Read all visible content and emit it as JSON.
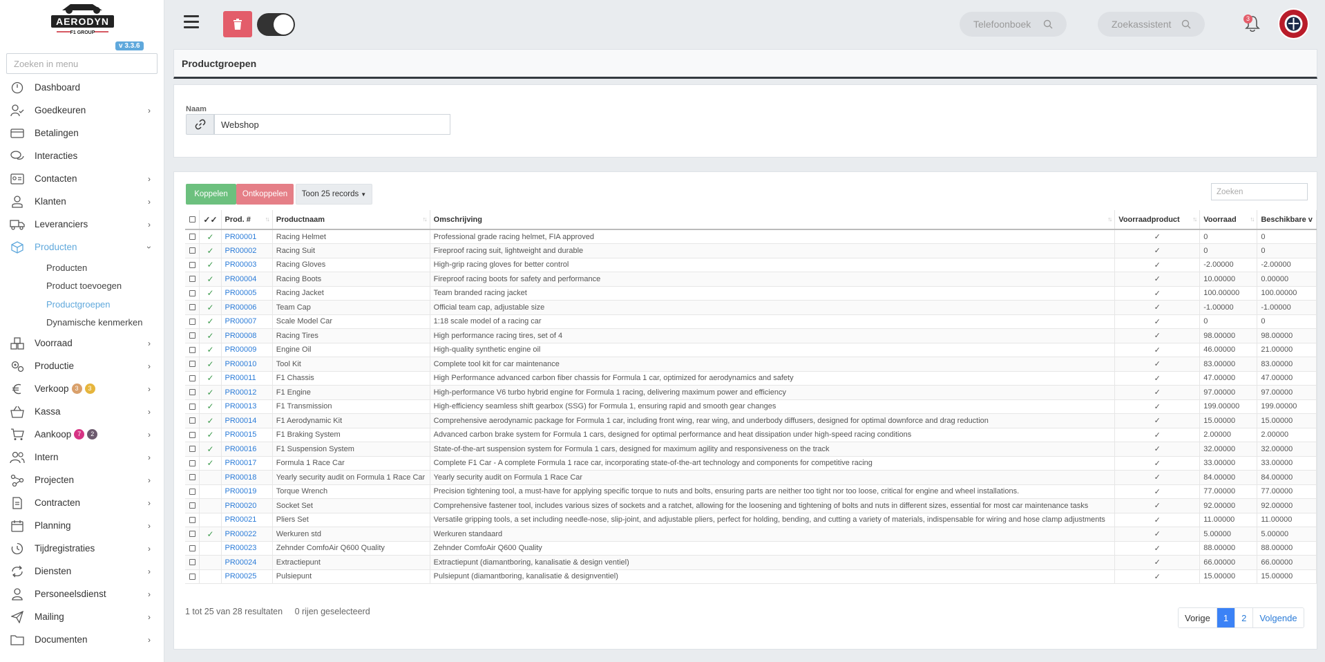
{
  "app": {
    "logo_text": "AERODYN",
    "logo_subtext": "F1 GROUP",
    "version": "v 3.3.6"
  },
  "sidebar": {
    "search_placeholder": "Zoeken in menu",
    "items": [
      {
        "label": "Dashboard",
        "icon": "dashboard-icon",
        "chevron": false
      },
      {
        "label": "Goedkeuren",
        "icon": "user-check-icon",
        "chevron": true
      },
      {
        "label": "Betalingen",
        "icon": "credit-card-icon",
        "chevron": false
      },
      {
        "label": "Interacties",
        "icon": "chat-icon",
        "chevron": false
      },
      {
        "label": "Contacten",
        "icon": "contact-card-icon",
        "chevron": true
      },
      {
        "label": "Klanten",
        "icon": "customer-icon",
        "chevron": true
      },
      {
        "label": "Leveranciers",
        "icon": "truck-icon",
        "chevron": true
      },
      {
        "label": "Producten",
        "icon": "box-icon",
        "chevron": true,
        "active": true
      }
    ],
    "submenu": [
      {
        "label": "Producten"
      },
      {
        "label": "Product toevoegen"
      },
      {
        "label": "Productgroepen",
        "active": true
      },
      {
        "label": "Dynamische kenmerken"
      }
    ],
    "items_after": [
      {
        "label": "Voorraad",
        "icon": "boxes-icon"
      },
      {
        "label": "Productie",
        "icon": "gears-icon"
      },
      {
        "label": "Verkoop",
        "icon": "euro-icon",
        "badges": [
          {
            "value": "3",
            "color": "#d9a06b"
          },
          {
            "value": "3",
            "color": "#e6b53c"
          }
        ]
      },
      {
        "label": "Kassa",
        "icon": "basket-icon"
      },
      {
        "label": "Aankoop",
        "icon": "cart-icon",
        "badges": [
          {
            "value": "7",
            "color": "#d63384"
          },
          {
            "value": "2",
            "color": "#6c5a6e"
          }
        ]
      },
      {
        "label": "Intern",
        "icon": "users-icon"
      },
      {
        "label": "Projecten",
        "icon": "project-icon"
      },
      {
        "label": "Contracten",
        "icon": "contract-icon"
      },
      {
        "label": "Planning",
        "icon": "calendar-icon"
      },
      {
        "label": "Tijdregistraties",
        "icon": "clock-icon"
      },
      {
        "label": "Diensten",
        "icon": "cycle-icon"
      },
      {
        "label": "Personeelsdienst",
        "icon": "person-icon"
      },
      {
        "label": "Mailing",
        "icon": "send-icon"
      },
      {
        "label": "Documenten",
        "icon": "folder-icon"
      }
    ]
  },
  "topbar": {
    "phonebook_placeholder": "Telefoonboek",
    "assistant_placeholder": "Zoekassistent",
    "notification_count": "3"
  },
  "page": {
    "title": "Productgroepen",
    "name_label": "Naam",
    "name_value": "Webshop"
  },
  "table_toolbar": {
    "link_button": "Koppelen",
    "unlink_button": "Ontkoppelen",
    "show_records": "Toon 25 records",
    "search_placeholder": "Zoeken"
  },
  "table": {
    "headers": [
      "Prod. #",
      "Productnaam",
      "Omschrijving",
      "Voorraadproduct",
      "Voorraad",
      "Beschikbare v"
    ],
    "rows": [
      {
        "linked": true,
        "id": "PR00001",
        "name": "Racing Helmet",
        "desc": "Professional grade racing helmet, FIA approved",
        "stock": "0",
        "avail": "0"
      },
      {
        "linked": true,
        "id": "PR00002",
        "name": "Racing Suit",
        "desc": "Fireproof racing suit, lightweight and durable",
        "stock": "0",
        "avail": "0"
      },
      {
        "linked": true,
        "id": "PR00003",
        "name": "Racing Gloves",
        "desc": "High-grip racing gloves for better control",
        "stock": "-2.00000",
        "avail": "-2.00000"
      },
      {
        "linked": true,
        "id": "PR00004",
        "name": "Racing Boots",
        "desc": "Fireproof racing boots for safety and performance",
        "stock": "10.00000",
        "avail": "0.00000"
      },
      {
        "linked": true,
        "id": "PR00005",
        "name": "Racing Jacket",
        "desc": "Team branded racing jacket",
        "stock": "100.00000",
        "avail": "100.00000"
      },
      {
        "linked": true,
        "id": "PR00006",
        "name": "Team Cap",
        "desc": "Official team cap, adjustable size",
        "stock": "-1.00000",
        "avail": "-1.00000"
      },
      {
        "linked": true,
        "id": "PR00007",
        "name": "Scale Model Car",
        "desc": "1:18 scale model of a racing car",
        "stock": "0",
        "avail": "0"
      },
      {
        "linked": true,
        "id": "PR00008",
        "name": "Racing Tires",
        "desc": "High performance racing tires, set of 4",
        "stock": "98.00000",
        "avail": "98.00000"
      },
      {
        "linked": true,
        "id": "PR00009",
        "name": "Engine Oil",
        "desc": "High-quality synthetic engine oil",
        "stock": "46.00000",
        "avail": "21.00000"
      },
      {
        "linked": true,
        "id": "PR00010",
        "name": "Tool Kit",
        "desc": "Complete tool kit for car maintenance",
        "stock": "83.00000",
        "avail": "83.00000"
      },
      {
        "linked": true,
        "id": "PR00011",
        "name": "F1 Chassis",
        "desc": "High Performance advanced carbon fiber chassis for Formula 1 car, optimized for aerodynamics and safety",
        "stock": "47.00000",
        "avail": "47.00000"
      },
      {
        "linked": true,
        "id": "PR00012",
        "name": "F1 Engine",
        "desc": "High-performance V6 turbo hybrid engine for Formula 1 racing, delivering maximum power and efficiency",
        "stock": "97.00000",
        "avail": "97.00000"
      },
      {
        "linked": true,
        "id": "PR00013",
        "name": "F1 Transmission",
        "desc": "High-efficiency seamless shift gearbox (SSG) for Formula 1, ensuring rapid and smooth gear changes",
        "stock": "199.00000",
        "avail": "199.00000"
      },
      {
        "linked": true,
        "id": "PR00014",
        "name": "F1 Aerodynamic Kit",
        "desc": "Comprehensive aerodynamic package for Formula 1 car, including front wing, rear wing, and underbody diffusers, designed for optimal downforce and drag reduction",
        "stock": "15.00000",
        "avail": "15.00000"
      },
      {
        "linked": true,
        "id": "PR00015",
        "name": "F1 Braking System",
        "desc": "Advanced carbon brake system for Formula 1 cars, designed for optimal performance and heat dissipation under high-speed racing conditions",
        "stock": "2.00000",
        "avail": "2.00000"
      },
      {
        "linked": true,
        "id": "PR00016",
        "name": "F1 Suspension System",
        "desc": "State-of-the-art suspension system for Formula 1 cars, designed for maximum agility and responsiveness on the track",
        "stock": "32.00000",
        "avail": "32.00000"
      },
      {
        "linked": true,
        "id": "PR00017",
        "name": "Formula 1 Race Car",
        "desc": "Complete F1 Car - A complete Formula 1 race car, incorporating state-of-the-art technology and components for competitive racing",
        "stock": "33.00000",
        "avail": "33.00000"
      },
      {
        "linked": false,
        "id": "PR00018",
        "name": "Yearly security audit on Formula 1 Race Car",
        "desc": "Yearly security audit on Formula 1 Race Car",
        "stock": "84.00000",
        "avail": "84.00000"
      },
      {
        "linked": false,
        "id": "PR00019",
        "name": "Torque Wrench",
        "desc": "Precision tightening tool, a must-have for applying specific torque to nuts and bolts, ensuring parts are neither too tight nor too loose, critical for engine and wheel installations.",
        "stock": "77.00000",
        "avail": "77.00000"
      },
      {
        "linked": false,
        "id": "PR00020",
        "name": "Socket Set",
        "desc": "Comprehensive fastener tool, includes various sizes of sockets and a ratchet, allowing for the loosening and tightening of bolts and nuts in different sizes, essential for most car maintenance tasks",
        "stock": "92.00000",
        "avail": "92.00000"
      },
      {
        "linked": false,
        "id": "PR00021",
        "name": "Pliers Set",
        "desc": "Versatile gripping tools, a set including needle-nose, slip-joint, and adjustable pliers, perfect for holding, bending, and cutting a variety of materials, indispensable for wiring and hose clamp adjustments",
        "stock": "11.00000",
        "avail": "11.00000"
      },
      {
        "linked": true,
        "id": "PR00022",
        "name": "Werkuren std",
        "desc": "Werkuren standaard",
        "stock": "5.00000",
        "avail": "5.00000"
      },
      {
        "linked": false,
        "id": "PR00023",
        "name": "Zehnder ComfoAir Q600 Quality",
        "desc": "Zehnder ComfoAir Q600 Quality",
        "stock": "88.00000",
        "avail": "88.00000"
      },
      {
        "linked": false,
        "id": "PR00024",
        "name": "Extractiepunt",
        "desc": "Extractiepunt (diamantboring, kanalisatie & design ventiel)",
        "stock": "66.00000",
        "avail": "66.00000"
      },
      {
        "linked": false,
        "id": "PR00025",
        "name": "Pulsiepunt",
        "desc": "Pulsiepunt (diamantboring, kanalisatie & designventiel)",
        "stock": "15.00000",
        "avail": "15.00000"
      }
    ]
  },
  "footer": {
    "results_text": "1 tot 25 van 28 resultaten",
    "selected_text": "0 rijen geselecteerd",
    "prev": "Vorige",
    "pages": [
      "1",
      "2"
    ],
    "current_page": "1",
    "next": "Volgende"
  },
  "colors": {
    "accent": "#5fa8dc",
    "success": "#6cc07e",
    "danger": "#e57f87",
    "link": "#2a7bd8",
    "page_active": "#3b82f6"
  }
}
